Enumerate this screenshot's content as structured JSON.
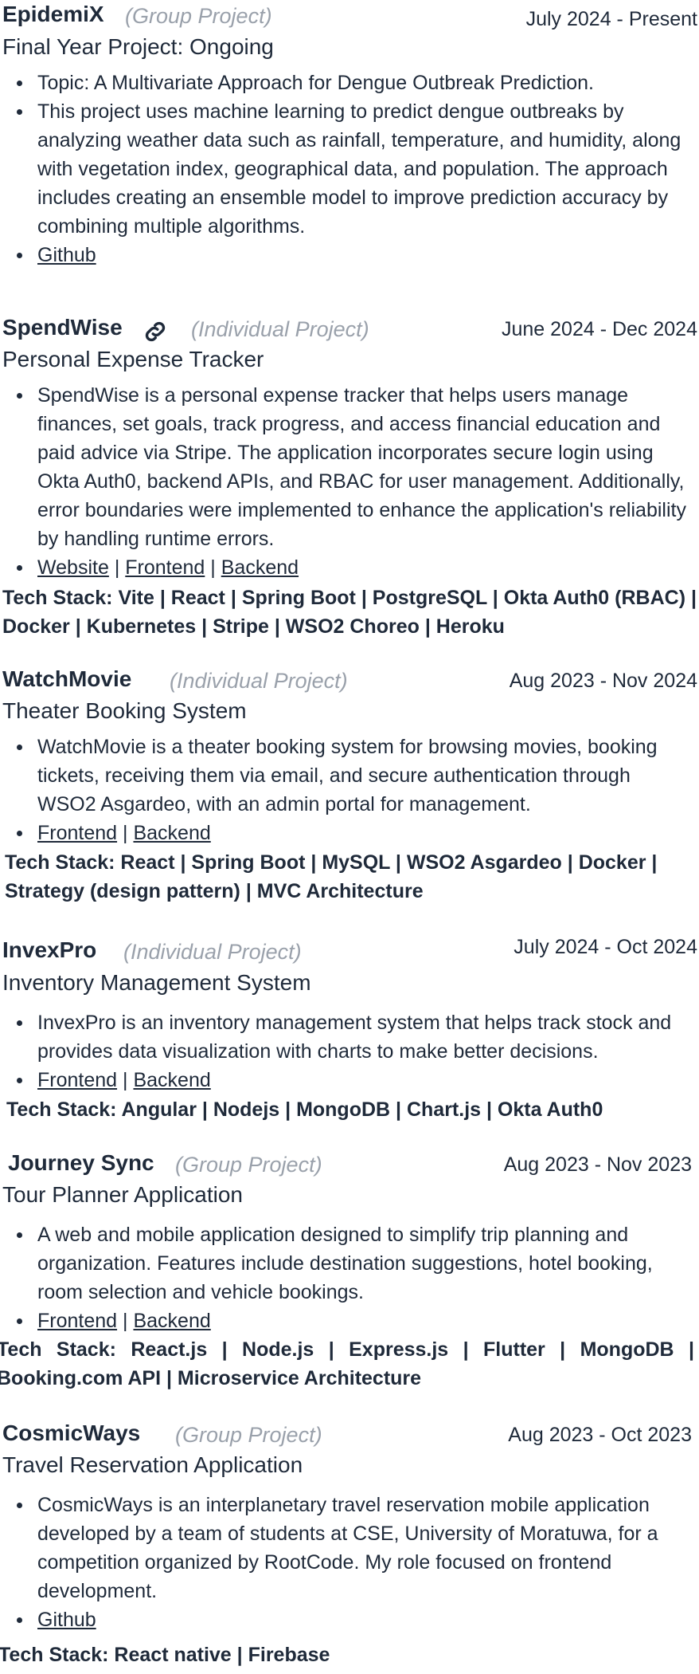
{
  "projects": [
    {
      "name": "EpidemiX",
      "kind": "(Group Project)",
      "date": "July 2024 - Present",
      "subtitle": "Final Year Project: Ongoing",
      "bullets": [
        "Topic: A Multivariate Approach for Dengue Outbreak Prediction.",
        "This project uses machine learning to predict dengue outbreaks by analyzing weather data such as rainfall, temperature, and humidity, along with vegetation index, geographical data, and population. The approach includes creating an ensemble model to improve prediction accuracy by combining multiple algorithms."
      ],
      "links": [
        "Github"
      ]
    },
    {
      "name": "SpendWise",
      "kind": "(Individual Project)",
      "date": "June 2024 - Dec 2024",
      "subtitle": "Personal Expense Tracker",
      "bullets": [
        "SpendWise is a personal expense tracker that helps users manage finances, set goals, track progress, and access financial education and paid advice via Stripe. The application incorporates secure login using Okta Auth0, backend APIs, and RBAC for user management. Additionally, error boundaries were implemented to enhance the application's reliability by handling runtime errors."
      ],
      "links": [
        "Website",
        "Frontend",
        "Backend"
      ],
      "tech": "Tech Stack: Vite | React | Spring Boot | PostgreSQL | Okta Auth0 (RBAC) | Docker | Kubernetes | Stripe | WSO2 Choreo | Heroku"
    },
    {
      "name": "WatchMovie",
      "kind": "(Individual Project)",
      "date": "Aug 2023 - Nov 2024",
      "subtitle": "Theater Booking System",
      "bullets": [
        "WatchMovie is a theater booking system for browsing movies, booking tickets, receiving them via email, and secure authentication through WSO2 Asgardeo, with an admin portal for management."
      ],
      "links": [
        "Frontend",
        "Backend"
      ],
      "tech": "Tech Stack: React | Spring Boot | MySQL | WSO2 Asgardeo | Docker | Strategy (design pattern) | MVC Architecture"
    },
    {
      "name": "InvexPro",
      "kind": "(Individual Project)",
      "date": "July 2024 - Oct 2024",
      "subtitle": "Inventory Management System",
      "bullets": [
        "InvexPro is an inventory management system that helps track stock and provides data visualization with charts to make better decisions."
      ],
      "links": [
        "Frontend",
        "Backend"
      ],
      "tech": "Tech Stack: Angular | Nodejs | MongoDB | Chart.js | Okta Auth0"
    },
    {
      "name": "Journey Sync",
      "kind": "(Group Project)",
      "date": "Aug 2023 - Nov 2023",
      "subtitle": "Tour Planner Application",
      "bullets": [
        "A web and mobile application designed to simplify trip planning and organization. Features include destination suggestions, hotel booking, room selection and vehicle bookings."
      ],
      "links": [
        "Frontend",
        "Backend"
      ],
      "tech": "Tech Stack: React.js | Node.js | Express.js | Flutter | MongoDB | Booking.com API | Microservice Architecture"
    },
    {
      "name": "CosmicWays",
      "kind": "(Group Project)",
      "date": "Aug 2023 - Oct 2023",
      "subtitle": "Travel Reservation Application",
      "bullets": [
        "CosmicWays is an interplanetary travel reservation mobile application developed by a team of students at CSE, University of Moratuwa, for a competition organized by RootCode. My role focused on frontend development."
      ],
      "links": [
        "Github"
      ],
      "tech": "Tech Stack: React native | Firebase"
    }
  ]
}
